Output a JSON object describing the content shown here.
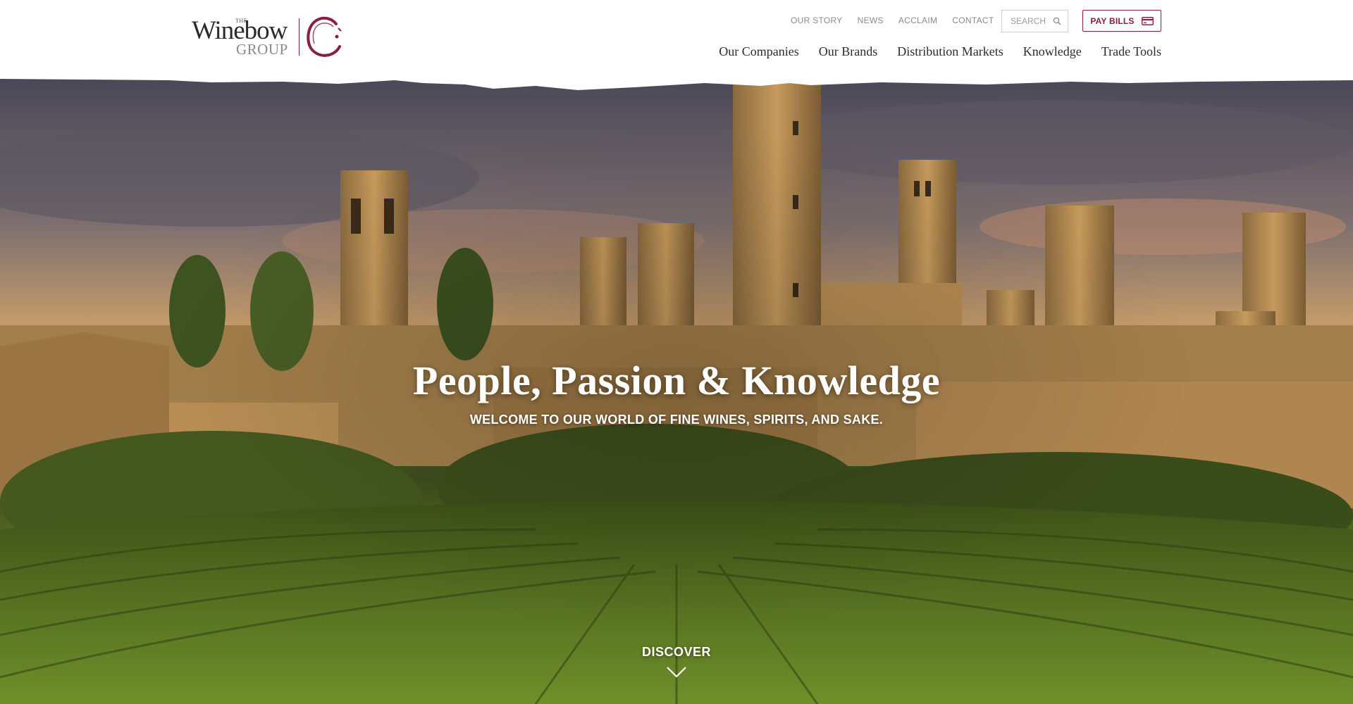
{
  "brand": {
    "logo_the": "THE",
    "logo_word": "Winebow",
    "logo_group": "GROUP",
    "accent_color": "#8b1e3f"
  },
  "utility_nav": {
    "items": [
      {
        "label": "OUR STORY"
      },
      {
        "label": "NEWS"
      },
      {
        "label": "ACCLAIM"
      },
      {
        "label": "CONTACT"
      }
    ]
  },
  "search": {
    "placeholder": "SEARCH",
    "icon": "search-icon"
  },
  "pay_bills": {
    "label": "PAY BILLS",
    "icon": "credit-card-icon"
  },
  "main_nav": {
    "items": [
      {
        "label": "Our Companies"
      },
      {
        "label": "Our Brands"
      },
      {
        "label": "Distribution Markets"
      },
      {
        "label": "Knowledge"
      },
      {
        "label": "Trade Tools"
      }
    ]
  },
  "hero": {
    "title": "People, Passion & Knowledge",
    "subtitle": "WELCOME TO OUR WORLD OF FINE WINES, SPIRITS, AND SAKE.",
    "discover_label": "DISCOVER",
    "discover_icon": "chevron-down-icon"
  }
}
